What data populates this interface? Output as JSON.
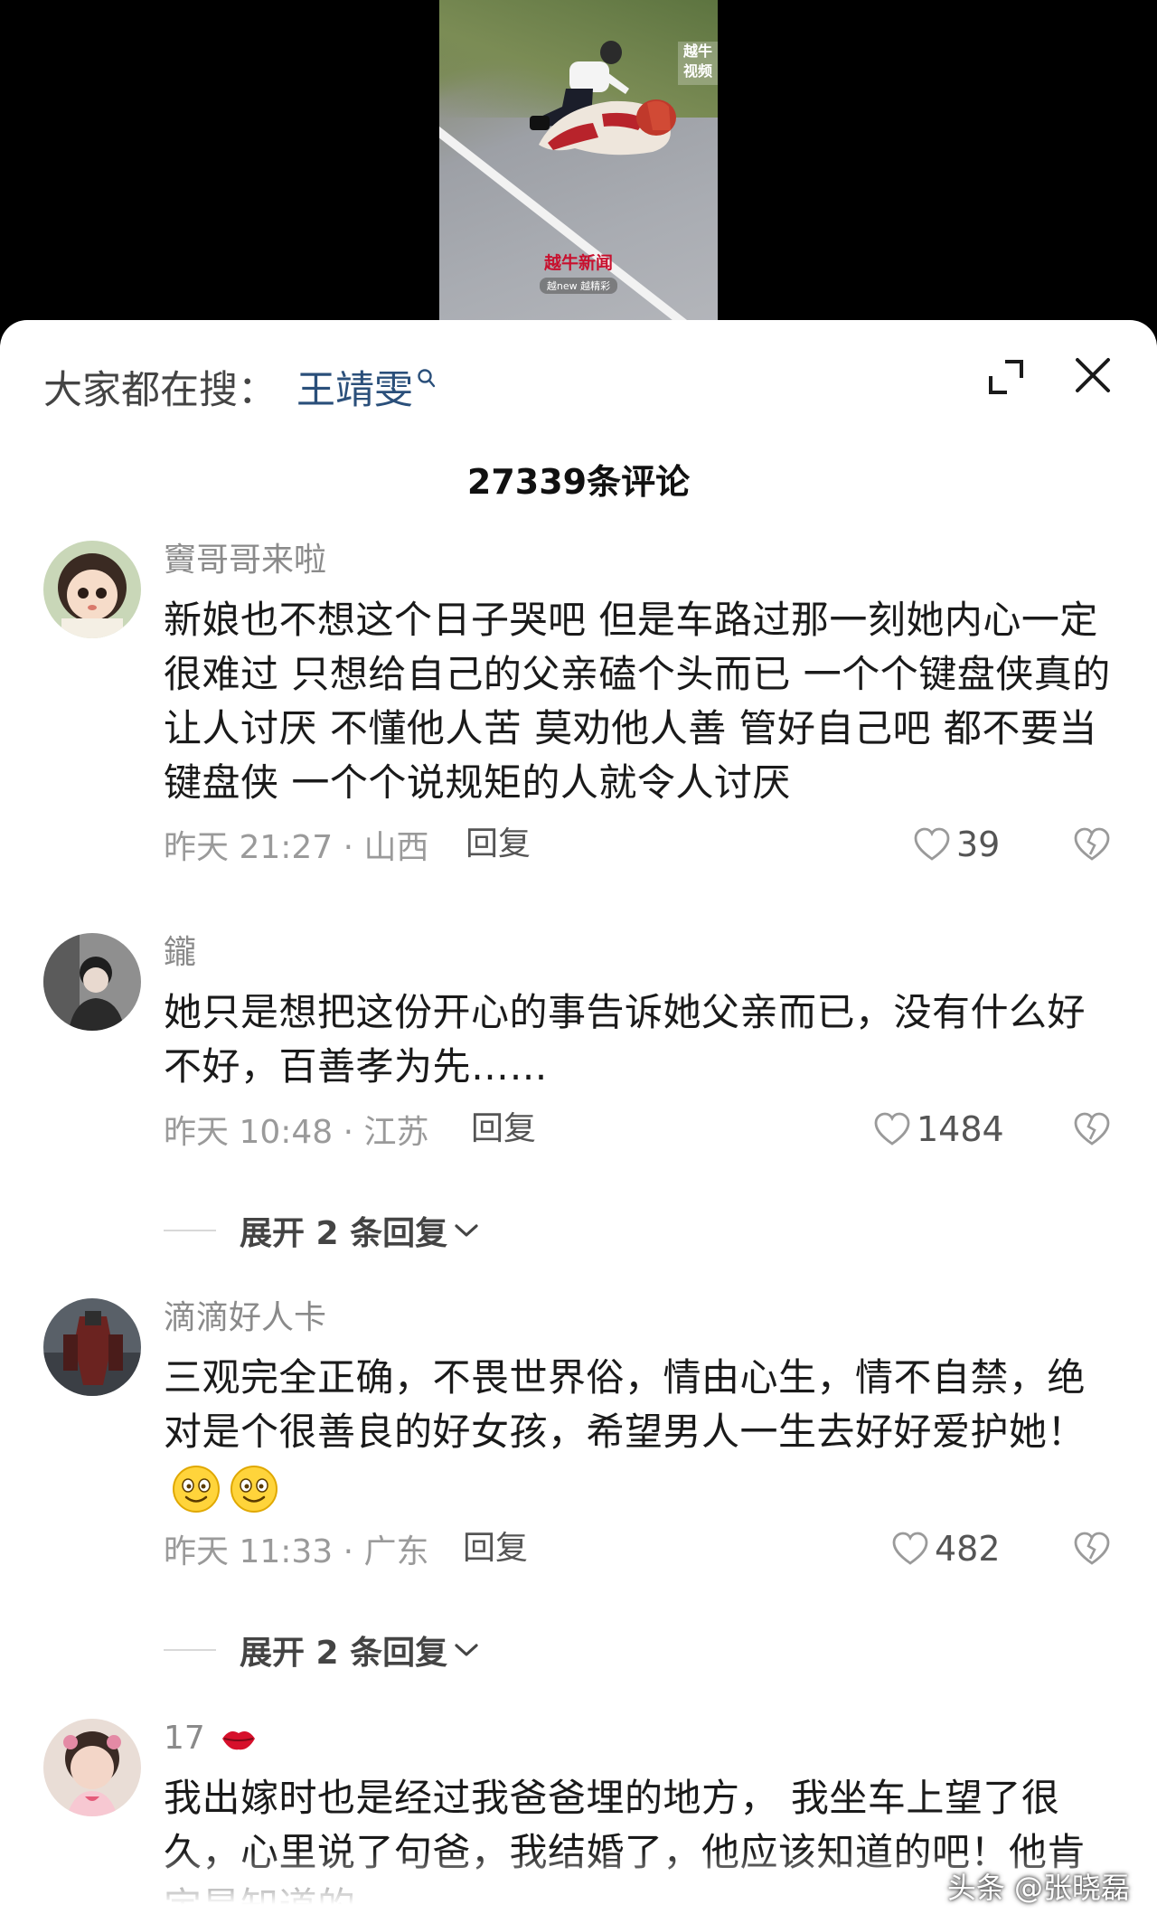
{
  "video": {
    "watermark_top": "越牛视频",
    "watermark_bottom_title": "越牛新闻",
    "watermark_bottom_sub": "越new 越精彩"
  },
  "search_bar": {
    "label": "大家都在搜：",
    "term": "王靖雯"
  },
  "comment_count": "27339条评论",
  "comments": [
    {
      "username": "竇哥哥来啦",
      "text": "新娘也不想这个日子哭吧 但是车路过那一刻她内心一定很难过 只想给自己的父亲磕个头而已 一个个键盘侠真的让人讨厌 不懂他人苦 莫劝他人善 管好自己吧 都不要当键盘侠 一个个说规矩的人就令人讨厌",
      "time": "昨天 21:27 · 山西",
      "reply_label": "回复",
      "likes": "39"
    },
    {
      "username": "鑨",
      "text": "她只是想把这份开心的事告诉她父亲而已，没有什么好不好，百善孝为先……",
      "time": "昨天 10:48 · 江苏",
      "reply_label": "回复",
      "likes": "1484",
      "expand_label": "展开 2 条回复"
    },
    {
      "username": "滴滴好人卡",
      "text": "三观完全正确，不畏世界俗，情由心生，情不自禁，绝对是个很善良的好女孩，希望男人一生去好好爱护她！",
      "time": "昨天 11:33 · 广东",
      "reply_label": "回复",
      "likes": "482",
      "expand_label": "展开 2 条回复"
    },
    {
      "username": "17",
      "text": "我出嫁时也是经过我爸爸埋的地方， 我坐车上望了很久，心里说了句爸，我结婚了，他应该知道的吧！他肯定是知道的"
    }
  ],
  "footer_watermark": "头条 @张晓磊",
  "colors": {
    "accent_link": "#2a4f7a",
    "meta_gray": "#9a9a9a"
  }
}
